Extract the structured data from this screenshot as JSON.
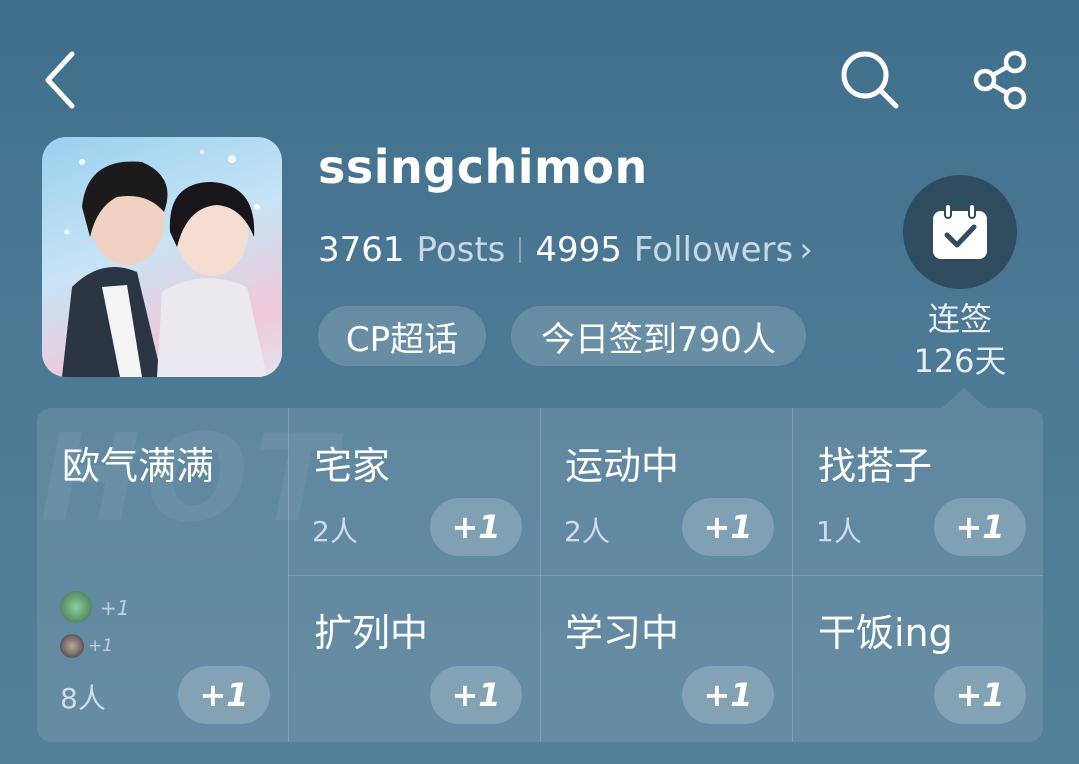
{
  "header": {
    "back_icon": "chevron-left-icon",
    "search_icon": "search-icon",
    "share_icon": "share-icon"
  },
  "profile": {
    "username": "ssingchimon",
    "posts_count": "3761",
    "posts_label": "Posts",
    "followers_count": "4995",
    "followers_label": "Followers",
    "followers_chevron": "›",
    "tags": [
      "CP超话",
      "今日签到790人"
    ]
  },
  "checkin": {
    "icon": "calendar-check-icon",
    "line1": "连签",
    "line2": "126天"
  },
  "hot_watermark": "HOT",
  "moods": [
    {
      "title": "欧气满满",
      "count": "8人",
      "button": "+1",
      "recent": [
        "+1",
        "+1"
      ]
    },
    {
      "title": "宅家",
      "count": "2人",
      "button": "+1"
    },
    {
      "title": "运动中",
      "count": "2人",
      "button": "+1"
    },
    {
      "title": "找搭子",
      "count": "1人",
      "button": "+1"
    },
    {
      "title": "扩列中",
      "count": "",
      "button": "+1"
    },
    {
      "title": "学习中",
      "count": "",
      "button": "+1"
    },
    {
      "title": "干饭ing",
      "count": "",
      "button": "+1"
    }
  ],
  "colors": {
    "background": "#4b7894",
    "checkin_circle": "#2f4d5f"
  }
}
